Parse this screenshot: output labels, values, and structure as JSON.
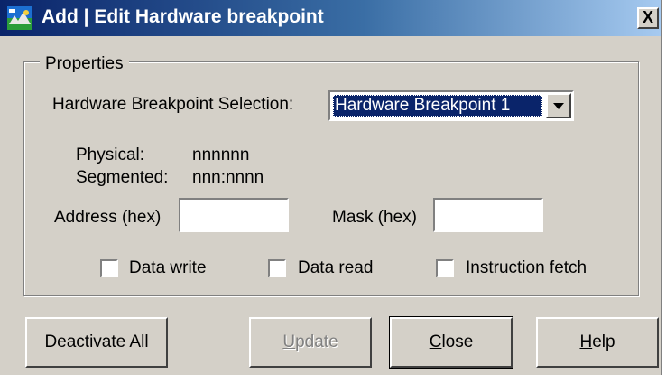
{
  "window": {
    "title": "Add | Edit Hardware breakpoint",
    "close_glyph": "X",
    "icon": "breakpoint-app-icon"
  },
  "properties": {
    "group_label": "Properties",
    "selection_label": "Hardware Breakpoint Selection:",
    "selection_value": "Hardware Breakpoint 1",
    "physical_label": "Physical:",
    "physical_value": "nnnnnn",
    "segmented_label": "Segmented:",
    "segmented_value": "nnn:nnnn",
    "address_label": "Address (hex)",
    "address_value": "",
    "mask_label": "Mask (hex)",
    "mask_value": "",
    "checkboxes": [
      {
        "label": "Data write",
        "checked": false
      },
      {
        "label": "Data read",
        "checked": false
      },
      {
        "label": "Instruction fetch",
        "checked": false
      }
    ]
  },
  "buttons": {
    "deactivate_all": "Deactivate All",
    "update_mnemonic": "U",
    "update_rest": "pdate",
    "close_mnemonic": "C",
    "close_rest": "lose",
    "help_mnemonic": "H",
    "help_rest": "elp"
  }
}
